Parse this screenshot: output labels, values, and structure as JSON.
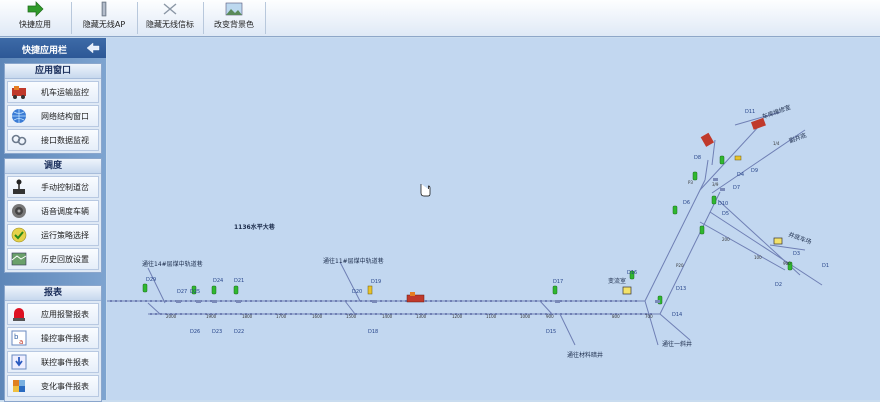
{
  "toolbar": {
    "buttons": [
      {
        "label": "快捷应用",
        "icon": "green-arrow-icon"
      },
      {
        "label": "隐藏无线AP",
        "icon": "antenna-icon"
      },
      {
        "label": "隐藏无线信标",
        "icon": "beacon-icon"
      },
      {
        "label": "改变背景色",
        "icon": "landscape-icon"
      }
    ]
  },
  "sidebar": {
    "title": "快捷应用栏",
    "groups": [
      {
        "title": "应用窗口",
        "items": [
          "机车运输监控",
          "网络结构窗口",
          "接口数据监视"
        ]
      },
      {
        "title": "调度",
        "items": [
          "手动控制道岔",
          "语音调度车辆",
          "运行策略选择",
          "历史回放设置"
        ]
      },
      {
        "title": "报表",
        "items": [
          "应用报警报表",
          "操控事件报表",
          "联控事件报表",
          "变化事件报表"
        ]
      }
    ]
  },
  "map": {
    "title": "1136水平大巷",
    "labels": {
      "lane14": "通往14#层煤中轨道巷",
      "lane11": "通往11#层煤中轨道巷",
      "substation": "变流室",
      "material": "通往材料暗井",
      "shaft1": "通往一斜井",
      "shed": "车库维修室",
      "depot": "井底车场",
      "repair": "副井底"
    },
    "distances": [
      "2000",
      "1900",
      "1800",
      "1700",
      "1600",
      "1500",
      "1400",
      "1300",
      "1200",
      "1100",
      "1000",
      "900",
      "800",
      "700"
    ],
    "signals_top": [
      "D29",
      "D27",
      "D25",
      "D24",
      "D21",
      "D20",
      "D19",
      "D17",
      "D16",
      "D13",
      "D11",
      "D9",
      "D8",
      "D7",
      "D6",
      "D5",
      "D4",
      "D3",
      "D1"
    ],
    "signals_bottom": [
      "D26",
      "D23",
      "D22",
      "D18",
      "D15",
      "D14",
      "D10",
      "D2"
    ],
    "switch_ids": [
      "1/4",
      "3/9",
      "P20",
      "P3",
      "100",
      "200",
      "900"
    ]
  }
}
